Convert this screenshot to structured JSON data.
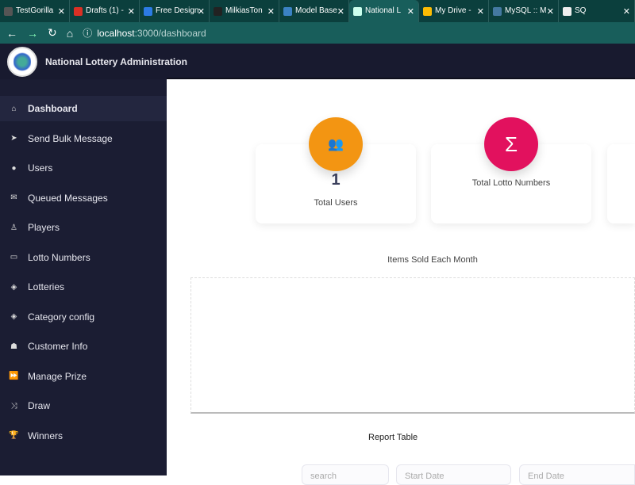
{
  "browser": {
    "tabs": [
      {
        "title": "TestGorilla",
        "color": "#555"
      },
      {
        "title": "Drafts (1) -",
        "color": "#d93025"
      },
      {
        "title": "Free Design",
        "color": "#2c7be5"
      },
      {
        "title": "MilkiasTon",
        "color": "#222"
      },
      {
        "title": "Model Base",
        "color": "#3b82c4"
      },
      {
        "title": "National L",
        "color": "#cfe",
        "active": true
      },
      {
        "title": "My Drive -",
        "color": "#fbbc04"
      },
      {
        "title": "MySQL :: M",
        "color": "#4479a1"
      },
      {
        "title": "SQ",
        "color": "#eee"
      }
    ],
    "url_host": "localhost",
    "url_path": ":3000/dashboard"
  },
  "header": {
    "title": "National Lottery Administration"
  },
  "sidebar": {
    "items": [
      {
        "label": "Dashboard",
        "icon": "home-icon",
        "glyph": "⌂",
        "active": true
      },
      {
        "label": "Send Bulk Message",
        "icon": "send-icon",
        "glyph": "➤"
      },
      {
        "label": "Users",
        "icon": "user-icon",
        "glyph": "●"
      },
      {
        "label": "Queued Messages",
        "icon": "envelope-icon",
        "glyph": "✉"
      },
      {
        "label": "Players",
        "icon": "player-icon",
        "glyph": "♙"
      },
      {
        "label": "Lotto Numbers",
        "icon": "ticket-icon",
        "glyph": "▭"
      },
      {
        "label": "Lotteries",
        "icon": "cube-icon",
        "glyph": "◈"
      },
      {
        "label": "Category config",
        "icon": "cube-icon",
        "glyph": "◈"
      },
      {
        "label": "Customer Info",
        "icon": "users-icon",
        "glyph": "☗"
      },
      {
        "label": "Manage Prize",
        "icon": "forward-icon",
        "glyph": "⏩"
      },
      {
        "label": "Draw",
        "icon": "shuffle-icon",
        "glyph": "⤨"
      },
      {
        "label": "Winners",
        "icon": "trophy-icon",
        "glyph": "🏆"
      }
    ]
  },
  "cards": [
    {
      "value": "1",
      "label": "Total Users",
      "color": "#f39512",
      "icon": "users-icon",
      "glyph": "👥"
    },
    {
      "value": "",
      "label": "Total Lotto Numbers",
      "color": "#e2115e",
      "icon": "sigma-icon",
      "glyph": "Σ"
    }
  ],
  "chart": {
    "title": "Items Sold Each Month"
  },
  "report": {
    "title": "Report Table",
    "search_placeholder": "search",
    "start_placeholder": "Start Date",
    "end_placeholder": "End Date"
  }
}
